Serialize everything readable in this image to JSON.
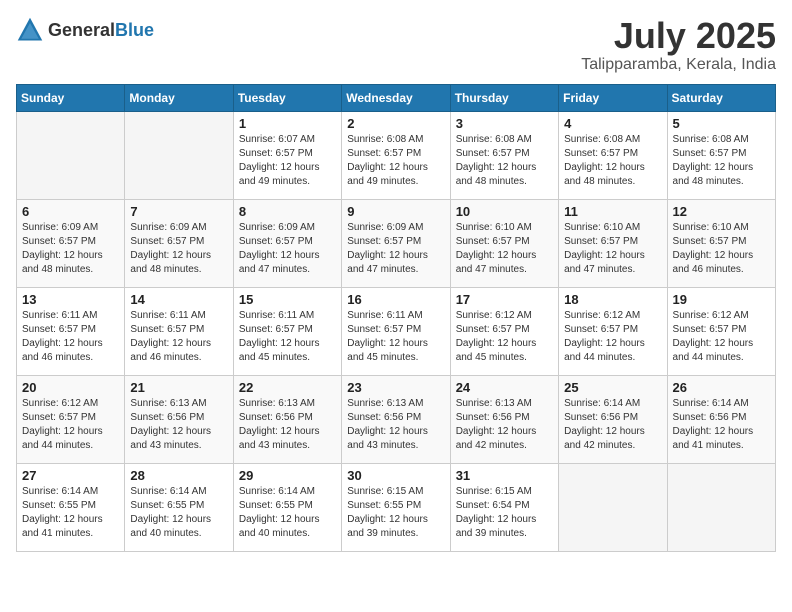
{
  "header": {
    "logo_general": "General",
    "logo_blue": "Blue",
    "month_year": "July 2025",
    "location": "Talipparamba, Kerala, India"
  },
  "days_of_week": [
    "Sunday",
    "Monday",
    "Tuesday",
    "Wednesday",
    "Thursday",
    "Friday",
    "Saturday"
  ],
  "weeks": [
    [
      {
        "day": "",
        "info": ""
      },
      {
        "day": "",
        "info": ""
      },
      {
        "day": "1",
        "info": "Sunrise: 6:07 AM\nSunset: 6:57 PM\nDaylight: 12 hours\nand 49 minutes."
      },
      {
        "day": "2",
        "info": "Sunrise: 6:08 AM\nSunset: 6:57 PM\nDaylight: 12 hours\nand 49 minutes."
      },
      {
        "day": "3",
        "info": "Sunrise: 6:08 AM\nSunset: 6:57 PM\nDaylight: 12 hours\nand 48 minutes."
      },
      {
        "day": "4",
        "info": "Sunrise: 6:08 AM\nSunset: 6:57 PM\nDaylight: 12 hours\nand 48 minutes."
      },
      {
        "day": "5",
        "info": "Sunrise: 6:08 AM\nSunset: 6:57 PM\nDaylight: 12 hours\nand 48 minutes."
      }
    ],
    [
      {
        "day": "6",
        "info": "Sunrise: 6:09 AM\nSunset: 6:57 PM\nDaylight: 12 hours\nand 48 minutes."
      },
      {
        "day": "7",
        "info": "Sunrise: 6:09 AM\nSunset: 6:57 PM\nDaylight: 12 hours\nand 48 minutes."
      },
      {
        "day": "8",
        "info": "Sunrise: 6:09 AM\nSunset: 6:57 PM\nDaylight: 12 hours\nand 47 minutes."
      },
      {
        "day": "9",
        "info": "Sunrise: 6:09 AM\nSunset: 6:57 PM\nDaylight: 12 hours\nand 47 minutes."
      },
      {
        "day": "10",
        "info": "Sunrise: 6:10 AM\nSunset: 6:57 PM\nDaylight: 12 hours\nand 47 minutes."
      },
      {
        "day": "11",
        "info": "Sunrise: 6:10 AM\nSunset: 6:57 PM\nDaylight: 12 hours\nand 47 minutes."
      },
      {
        "day": "12",
        "info": "Sunrise: 6:10 AM\nSunset: 6:57 PM\nDaylight: 12 hours\nand 46 minutes."
      }
    ],
    [
      {
        "day": "13",
        "info": "Sunrise: 6:11 AM\nSunset: 6:57 PM\nDaylight: 12 hours\nand 46 minutes."
      },
      {
        "day": "14",
        "info": "Sunrise: 6:11 AM\nSunset: 6:57 PM\nDaylight: 12 hours\nand 46 minutes."
      },
      {
        "day": "15",
        "info": "Sunrise: 6:11 AM\nSunset: 6:57 PM\nDaylight: 12 hours\nand 45 minutes."
      },
      {
        "day": "16",
        "info": "Sunrise: 6:11 AM\nSunset: 6:57 PM\nDaylight: 12 hours\nand 45 minutes."
      },
      {
        "day": "17",
        "info": "Sunrise: 6:12 AM\nSunset: 6:57 PM\nDaylight: 12 hours\nand 45 minutes."
      },
      {
        "day": "18",
        "info": "Sunrise: 6:12 AM\nSunset: 6:57 PM\nDaylight: 12 hours\nand 44 minutes."
      },
      {
        "day": "19",
        "info": "Sunrise: 6:12 AM\nSunset: 6:57 PM\nDaylight: 12 hours\nand 44 minutes."
      }
    ],
    [
      {
        "day": "20",
        "info": "Sunrise: 6:12 AM\nSunset: 6:57 PM\nDaylight: 12 hours\nand 44 minutes."
      },
      {
        "day": "21",
        "info": "Sunrise: 6:13 AM\nSunset: 6:56 PM\nDaylight: 12 hours\nand 43 minutes."
      },
      {
        "day": "22",
        "info": "Sunrise: 6:13 AM\nSunset: 6:56 PM\nDaylight: 12 hours\nand 43 minutes."
      },
      {
        "day": "23",
        "info": "Sunrise: 6:13 AM\nSunset: 6:56 PM\nDaylight: 12 hours\nand 43 minutes."
      },
      {
        "day": "24",
        "info": "Sunrise: 6:13 AM\nSunset: 6:56 PM\nDaylight: 12 hours\nand 42 minutes."
      },
      {
        "day": "25",
        "info": "Sunrise: 6:14 AM\nSunset: 6:56 PM\nDaylight: 12 hours\nand 42 minutes."
      },
      {
        "day": "26",
        "info": "Sunrise: 6:14 AM\nSunset: 6:56 PM\nDaylight: 12 hours\nand 41 minutes."
      }
    ],
    [
      {
        "day": "27",
        "info": "Sunrise: 6:14 AM\nSunset: 6:55 PM\nDaylight: 12 hours\nand 41 minutes."
      },
      {
        "day": "28",
        "info": "Sunrise: 6:14 AM\nSunset: 6:55 PM\nDaylight: 12 hours\nand 40 minutes."
      },
      {
        "day": "29",
        "info": "Sunrise: 6:14 AM\nSunset: 6:55 PM\nDaylight: 12 hours\nand 40 minutes."
      },
      {
        "day": "30",
        "info": "Sunrise: 6:15 AM\nSunset: 6:55 PM\nDaylight: 12 hours\nand 39 minutes."
      },
      {
        "day": "31",
        "info": "Sunrise: 6:15 AM\nSunset: 6:54 PM\nDaylight: 12 hours\nand 39 minutes."
      },
      {
        "day": "",
        "info": ""
      },
      {
        "day": "",
        "info": ""
      }
    ]
  ]
}
